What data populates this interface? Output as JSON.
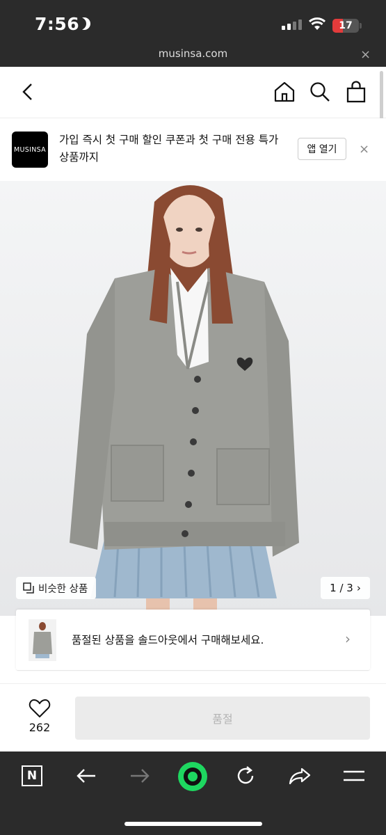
{
  "status_bar": {
    "time": "7:56",
    "battery_level": "17",
    "battery_color": "#e33b3b"
  },
  "url_bar": {
    "url": "musinsa.com",
    "close_label": "×"
  },
  "app_banner": {
    "logo_text": "MUSINSA",
    "message": "가입 즉시 첫 구매 할인 쿠폰과 첫 구매 전용 특가 상품까지",
    "open_label": "앱 열기",
    "close_label": "×"
  },
  "product_image": {
    "similar_label": "비슷한 상품",
    "counter": "1 / 3",
    "counter_arrow": "›"
  },
  "soldout_card": {
    "message": "품절된 상품을 솔드아웃에서 구매해보세요.",
    "arrow": "›"
  },
  "purchase_bar": {
    "like_count": "262",
    "button_label": "품절"
  },
  "browser_toolbar": {
    "tab_label": "N",
    "accent_color": "#1ed760"
  }
}
